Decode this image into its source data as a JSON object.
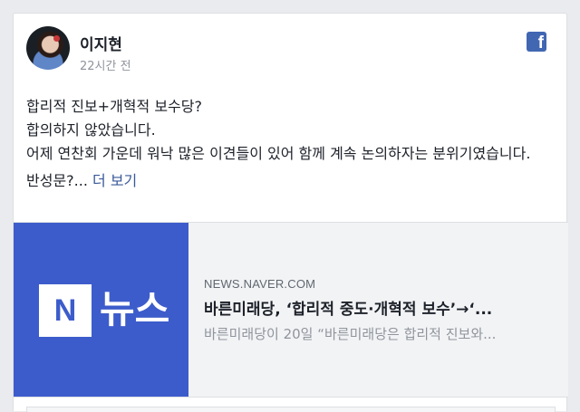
{
  "post": {
    "author": "이지현",
    "timestamp": "22시간 전",
    "lines": [
      "합리적 진보+개혁적 보수당?",
      "합의하지 않았습니다.",
      "어제 연찬회 가운데 워낙 많은 이견들이 있어 함께 계속 논의하자는 분위기였습니다."
    ],
    "teaser": "반성문?...",
    "see_more": "더 보기",
    "platform_icon": "facebook-icon"
  },
  "link_preview": {
    "thumb_letter": "N",
    "thumb_word": "뉴스",
    "domain": "NEWS.NAVER.COM",
    "title": "바른미래당, ‘합리적 중도·개혁적 보수’→‘...",
    "description": "바른미래당이 20일 “바른미래당은 합리적 진보와..."
  },
  "colors": {
    "facebook_blue": "#4267b2",
    "link_blue": "#385898",
    "naver_blue": "#3d5ccb"
  }
}
